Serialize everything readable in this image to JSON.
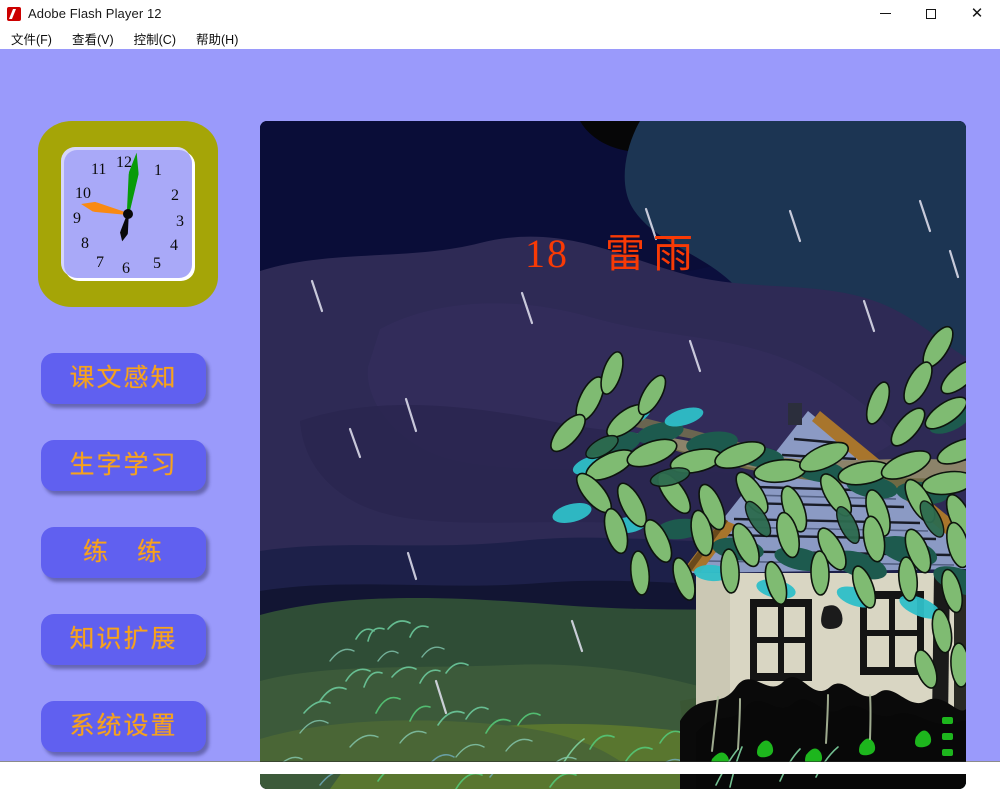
{
  "window": {
    "title": "Adobe Flash Player 12",
    "app_icon": "flash-logo-icon",
    "controls": {
      "minimize": "–",
      "maximize": "□",
      "close": "✕"
    }
  },
  "menubar": {
    "items": [
      {
        "label": "文件(F)",
        "name": "menu-file"
      },
      {
        "label": "查看(V)",
        "name": "menu-view"
      },
      {
        "label": "控制(C)",
        "name": "menu-control"
      },
      {
        "label": "帮助(H)",
        "name": "menu-help"
      }
    ]
  },
  "clock": {
    "numerals": [
      "12",
      "1",
      "2",
      "3",
      "4",
      "5",
      "6",
      "7",
      "8",
      "9",
      "10",
      "11"
    ],
    "frame_color": "#a5a507",
    "face_color": "#a9a9f8",
    "hands": {
      "minute_color": "#089b09",
      "second_color": "#f98a12",
      "hour_color": "#0a0a0a"
    }
  },
  "nav": {
    "buttons": [
      {
        "label": "课文感知",
        "name": "nav-button-text-perception"
      },
      {
        "label": "生字学习",
        "name": "nav-button-new-characters"
      },
      {
        "label": "练　练",
        "name": "nav-button-practice"
      },
      {
        "label": "知识扩展",
        "name": "nav-button-knowledge-extension"
      },
      {
        "label": "系统设置",
        "name": "nav-button-system-settings"
      }
    ],
    "button_color": "#6060f0",
    "text_color": "#f8a21a"
  },
  "illustration": {
    "lesson_number": "18",
    "lesson_title": "雷雨",
    "title_color": "#f93a05",
    "description": "storm-scene-house-tree-rain",
    "palette": {
      "sky_dark": "#0b0f3d",
      "cloud_purple": "#2e2a55",
      "cloud_blue": "#1d3556",
      "grass_dark": "#2f4d36",
      "grass_mid": "#4d6a3a",
      "grass_light": "#5e7a2c",
      "water": "#0d6a70",
      "leaf_green": "#7fbb72",
      "leaf_dark": "#1d5a4e",
      "roof": "#8b9ac4",
      "wall": "#d9d6c3",
      "eave": "#a8752c",
      "rain": "#e8e8f4"
    }
  },
  "page_background": "#9a9afb"
}
